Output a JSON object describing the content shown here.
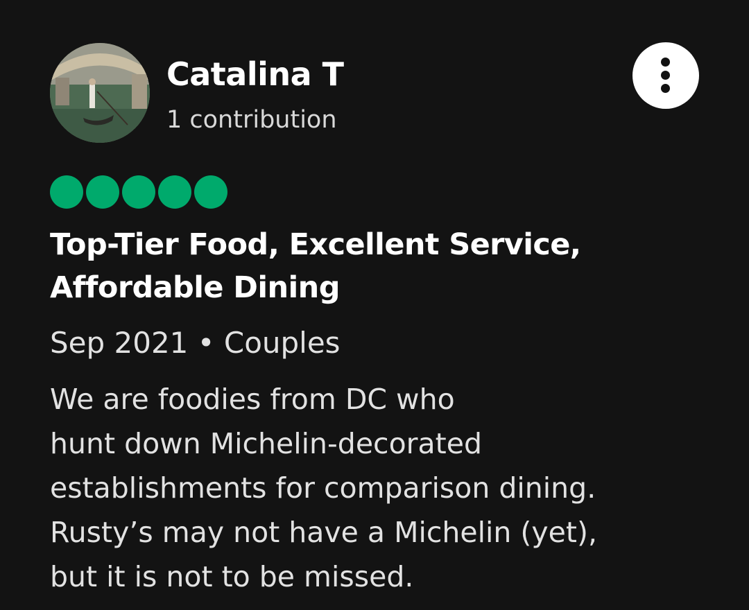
{
  "reviewer": {
    "name": "Catalina T",
    "contributions": "1 contribution",
    "avatar_icon": "gondola-photo-avatar"
  },
  "menu": {
    "icon": "more-vertical-icon"
  },
  "rating": {
    "filled": 5,
    "max": 5,
    "color": "#00aa6c"
  },
  "review": {
    "title": "Top-Tier Food, Excellent Service, Affordable Dining",
    "meta": "Sep 2021 • Couples",
    "body_lines": [
      "We are foodies from DC who",
      "hunt down Michelin-decorated",
      "establishments for comparison dining.",
      "Rusty’s may not have a Michelin (yet),",
      "but it is not to be missed."
    ]
  }
}
